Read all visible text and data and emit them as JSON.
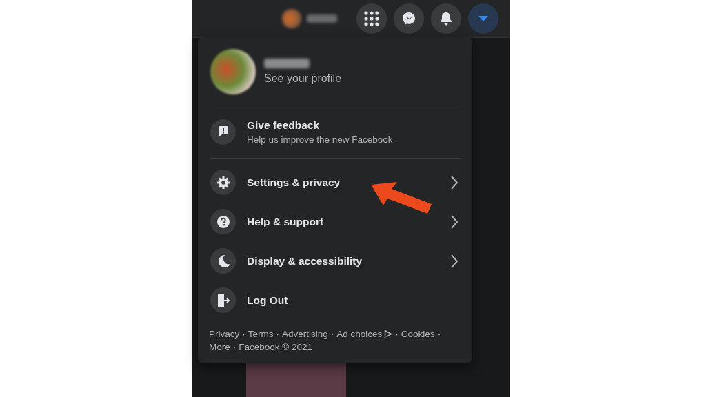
{
  "top_bar": {
    "buttons": [
      {
        "kind": "apps",
        "selected": false
      },
      {
        "kind": "messenger",
        "selected": false
      },
      {
        "kind": "notifications",
        "selected": false
      },
      {
        "kind": "account",
        "selected": true
      }
    ]
  },
  "menu": {
    "profile": {
      "subtitle": "See your profile"
    },
    "items": [
      {
        "kind": "feedback",
        "title": "Give feedback",
        "subtitle": "Help us improve the new Facebook",
        "has_submenu": false
      },
      {
        "kind": "settings",
        "title": "Settings & privacy",
        "has_submenu": true
      },
      {
        "kind": "help",
        "title": "Help & support",
        "has_submenu": true
      },
      {
        "kind": "display",
        "title": "Display & accessibility",
        "has_submenu": true
      },
      {
        "kind": "logout",
        "title": "Log Out",
        "has_submenu": false
      }
    ],
    "footer": {
      "separator": "·",
      "links": [
        {
          "text": "Privacy",
          "kind": "link"
        },
        {
          "text": "Terms",
          "kind": "link"
        },
        {
          "text": "Advertising",
          "kind": "link"
        },
        {
          "text": "Ad choices",
          "kind": "adchoices"
        },
        {
          "text": "Cookies",
          "kind": "link"
        },
        {
          "text": "More",
          "kind": "link"
        }
      ],
      "copyright": "Facebook © 2021"
    }
  },
  "annotation": {
    "kind": "arrow"
  }
}
